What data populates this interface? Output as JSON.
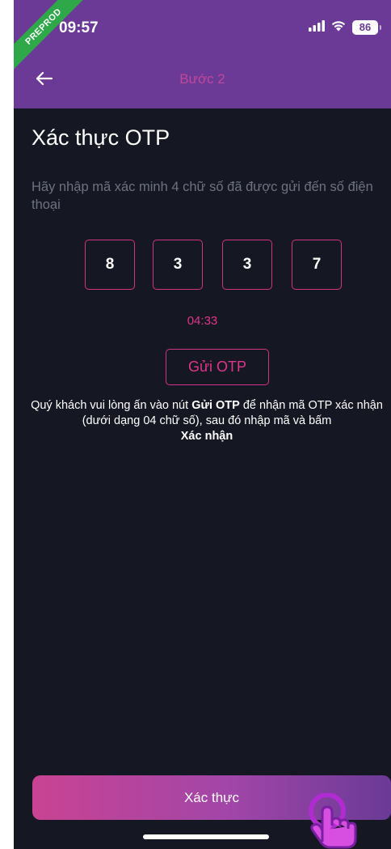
{
  "status_bar": {
    "env_badge": "PREPROD",
    "time": "09:57",
    "battery": "86",
    "signal_icon": "cellular-signal-icon",
    "wifi_icon": "wifi-icon"
  },
  "header": {
    "back_icon": "arrow-left-icon",
    "title": "Bước 2"
  },
  "main": {
    "heading": "Xác thực OTP",
    "instruction": "Hãy nhập mã xác minh 4 chữ số đã được gửi đến số điện thoại",
    "otp_digits": [
      "8",
      "3",
      "3",
      "7"
    ],
    "timer": "04:33",
    "send_otp_label": "Gửi OTP",
    "note": {
      "part1": "Quý khách vui lòng ấn vào nút ",
      "bold1": "Gửi OTP",
      "part2": " để nhận mã OTP xác nhận (dưới dạng 04 chữ số), sau đó nhập mã và bấm ",
      "bold2": "Xác nhận"
    }
  },
  "footer": {
    "confirm_label": "Xác thực"
  },
  "colors": {
    "accent": "#e0358c",
    "header_bg": "#6b3a96",
    "screen_bg": "#151822"
  }
}
